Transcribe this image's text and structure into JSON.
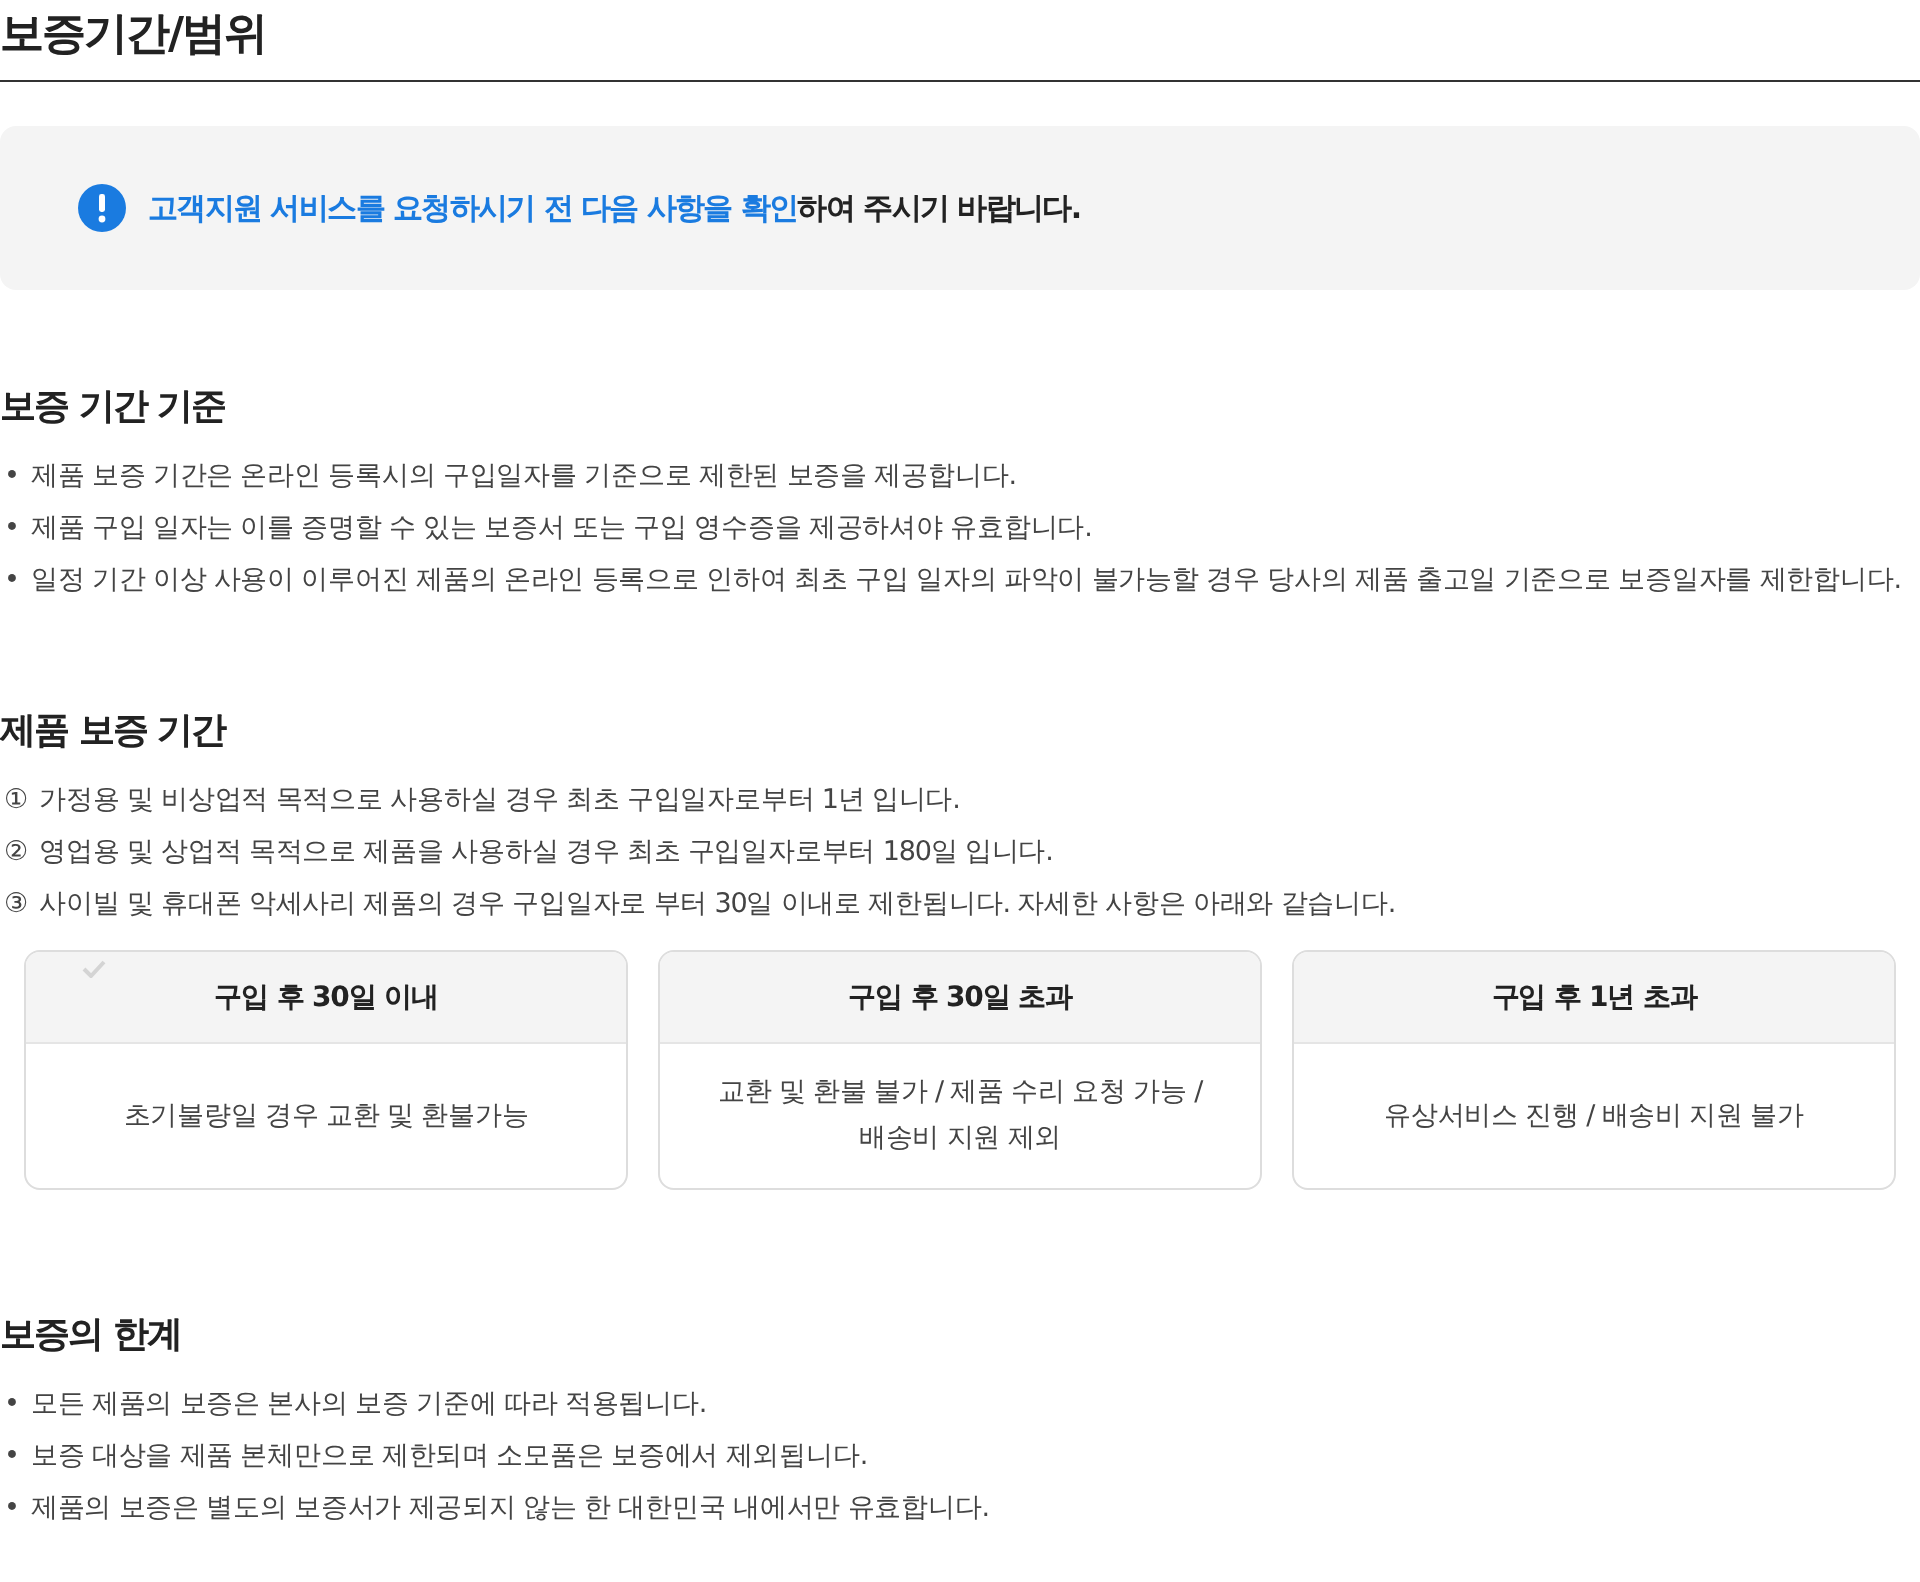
{
  "title": "보증기간/범위",
  "notice": {
    "highlight": "고객지원 서비스를 요청하시기 전 다음 사항을 확인",
    "rest": "하여 주시기 바랍니다."
  },
  "sections": [
    {
      "heading": "보증 기간 기준",
      "items": [
        {
          "marker": "•",
          "text": "제품 보증 기간은 온라인 등록시의 구입일자를 기준으로 제한된 보증을 제공합니다."
        },
        {
          "marker": "•",
          "text": "제품 구입 일자는 이를 증명할 수 있는 보증서 또는 구입 영수증을 제공하셔야 유효합니다."
        },
        {
          "marker": "•",
          "text": "일정 기간 이상 사용이 이루어진 제품의 온라인 등록으로 인하여 최초 구입 일자의 파악이 불가능할 경우 당사의 제품 출고일 기준으로 보증일자를 제한합니다."
        }
      ]
    },
    {
      "heading": "제품 보증 기간",
      "items": [
        {
          "marker": "①",
          "text": "가정용 및 비상업적 목적으로 사용하실 경우 최초 구입일자로부터 1년 입니다."
        },
        {
          "marker": "②",
          "text": "영업용 및 상업적 목적으로 제품을 사용하실 경우 최초 구입일자로부터 180일 입니다."
        },
        {
          "marker": "③",
          "text": "사이빌 및 휴대폰 악세사리 제품의 경우 구입일자로 부터 30일 이내로 제한됩니다. 자세한 사항은 아래와 같습니다."
        }
      ],
      "cards": [
        {
          "header": "구입 후 30일 이내",
          "body": "초기불량일 경우 교환 및 환불가능",
          "checked": true
        },
        {
          "header": "구입 후 30일 초과",
          "body": "교환 및 환불 불가 / 제품 수리 요청 가능 / 배송비 지원 제외",
          "checked": false
        },
        {
          "header": "구입 후 1년 초과",
          "body": "유상서비스 진행 / 배송비 지원 불가",
          "checked": false
        }
      ]
    },
    {
      "heading": "보증의 한계",
      "items": [
        {
          "marker": "•",
          "text": "모든 제품의 보증은 본사의 보증 기준에 따라 적용됩니다."
        },
        {
          "marker": "•",
          "text": "보증 대상을 제품 본체만으로 제한되며 소모품은 보증에서 제외됩니다."
        },
        {
          "marker": "•",
          "text": "제품의 보증은 별도의 보증서가 제공되지 않는 한 대한민국 내에서만 유효합니다."
        }
      ]
    }
  ]
}
